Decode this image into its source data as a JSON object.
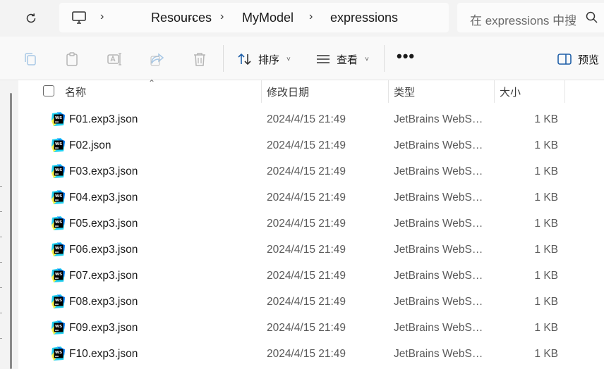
{
  "address": {
    "overflow": "…",
    "crumbs": [
      "Resources",
      "MyModel",
      "expressions"
    ],
    "separator": "›"
  },
  "search": {
    "placeholder": "在 expressions 中搜"
  },
  "toolbar": {
    "icons": [
      "copy-icon",
      "paste-icon",
      "rename-icon",
      "share-icon",
      "delete-icon"
    ],
    "sort_label": "排序",
    "view_label": "查看",
    "more_label": "•••",
    "preview_label": "预览",
    "caret": "˅"
  },
  "columns": {
    "name": "名称",
    "modified": "修改日期",
    "type": "类型",
    "size": "大小"
  },
  "files": [
    {
      "name": "F01.exp3.json",
      "modified": "2024/4/15 21:49",
      "type": "JetBrains WebSt…",
      "size": "1 KB"
    },
    {
      "name": "F02.json",
      "modified": "2024/4/15 21:49",
      "type": "JetBrains WebSt…",
      "size": "1 KB"
    },
    {
      "name": "F03.exp3.json",
      "modified": "2024/4/15 21:49",
      "type": "JetBrains WebSt…",
      "size": "1 KB"
    },
    {
      "name": "F04.exp3.json",
      "modified": "2024/4/15 21:49",
      "type": "JetBrains WebSt…",
      "size": "1 KB"
    },
    {
      "name": "F05.exp3.json",
      "modified": "2024/4/15 21:49",
      "type": "JetBrains WebSt…",
      "size": "1 KB"
    },
    {
      "name": "F06.exp3.json",
      "modified": "2024/4/15 21:49",
      "type": "JetBrains WebSt…",
      "size": "1 KB"
    },
    {
      "name": "F07.exp3.json",
      "modified": "2024/4/15 21:49",
      "type": "JetBrains WebSt…",
      "size": "1 KB"
    },
    {
      "name": "F08.exp3.json",
      "modified": "2024/4/15 21:49",
      "type": "JetBrains WebSt…",
      "size": "1 KB"
    },
    {
      "name": "F09.exp3.json",
      "modified": "2024/4/15 21:49",
      "type": "JetBrains WebSt…",
      "size": "1 KB"
    },
    {
      "name": "F10.exp3.json",
      "modified": "2024/4/15 21:49",
      "type": "JetBrains WebSt…",
      "size": "1 KB"
    }
  ],
  "file_icon": "webstorm-file-icon",
  "colors": {
    "accent": "#0067c0",
    "ws_cyan": "#21d0f0",
    "ws_blue": "#087cfa",
    "ws_yellow": "#fcf84a"
  }
}
